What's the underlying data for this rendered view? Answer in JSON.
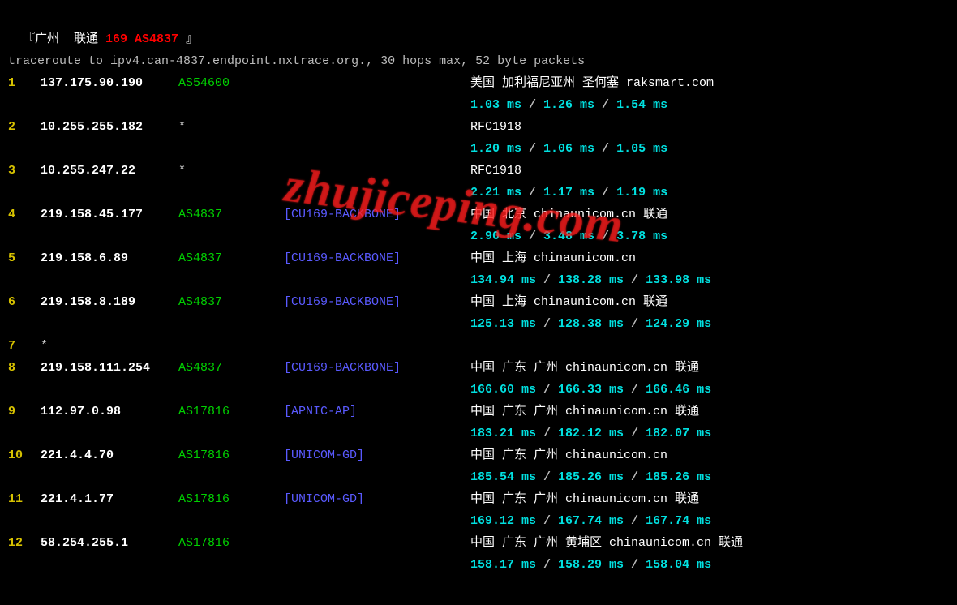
{
  "header": {
    "bracket_open": "『",
    "location": "广州  联通",
    "asn_text": " 169 AS4837",
    "bracket_close": " 』"
  },
  "trace_cmd": "traceroute to ipv4.can-4837.endpoint.nxtrace.org., 30 hops max, 52 byte packets",
  "watermark": "zhujiceping.com",
  "hops": [
    {
      "n": "1",
      "ip": "137.175.90.190",
      "asn": "AS54600",
      "tag": "",
      "loc": "美国 加利福尼亚州 圣何塞  raksmart.com",
      "lat": [
        "1.03 ms",
        "1.26 ms",
        "1.54 ms"
      ]
    },
    {
      "n": "2",
      "ip": "10.255.255.182",
      "asn": "*",
      "tag": "",
      "loc": "RFC1918",
      "lat": [
        "1.20 ms",
        "1.06 ms",
        "1.05 ms"
      ]
    },
    {
      "n": "3",
      "ip": "10.255.247.22",
      "asn": "*",
      "tag": "",
      "loc": "RFC1918",
      "lat": [
        "2.21 ms",
        "1.17 ms",
        "1.19 ms"
      ]
    },
    {
      "n": "4",
      "ip": "219.158.45.177",
      "asn": "AS4837",
      "tag": "[CU169-BACKBONE]",
      "loc": "中国 北京   chinaunicom.cn  联通",
      "lat": [
        "2.90 ms",
        "3.48 ms",
        "3.78 ms"
      ]
    },
    {
      "n": "5",
      "ip": "219.158.6.89",
      "asn": "AS4837",
      "tag": "[CU169-BACKBONE]",
      "loc": "中国 上海   chinaunicom.cn",
      "lat": [
        "134.94 ms",
        "138.28 ms",
        "133.98 ms"
      ]
    },
    {
      "n": "6",
      "ip": "219.158.8.189",
      "asn": "AS4837",
      "tag": "[CU169-BACKBONE]",
      "loc": "中国 上海   chinaunicom.cn  联通",
      "lat": [
        "125.13 ms",
        "128.38 ms",
        "124.29 ms"
      ]
    },
    {
      "n": "7",
      "ip": "*",
      "asn": "",
      "tag": "",
      "loc": "",
      "lat": null
    },
    {
      "n": "8",
      "ip": "219.158.111.254",
      "asn": "AS4837",
      "tag": "[CU169-BACKBONE]",
      "loc": "中国 广东 广州 chinaunicom.cn  联通",
      "lat": [
        "166.60 ms",
        "166.33 ms",
        "166.46 ms"
      ]
    },
    {
      "n": "9",
      "ip": "112.97.0.98",
      "asn": "AS17816",
      "tag": "[APNIC-AP]",
      "loc": "中国 广东 广州  chinaunicom.cn  联通",
      "lat": [
        "183.21 ms",
        "182.12 ms",
        "182.07 ms"
      ]
    },
    {
      "n": "10",
      "ip": "221.4.4.70",
      "asn": "AS17816",
      "tag": "[UNICOM-GD]",
      "loc": "中国 广东 广州  chinaunicom.cn",
      "lat": [
        "185.54 ms",
        "185.26 ms",
        "185.26 ms"
      ]
    },
    {
      "n": "11",
      "ip": "221.4.1.77",
      "asn": "AS17816",
      "tag": "[UNICOM-GD]",
      "loc": "中国 广东 广州  chinaunicom.cn  联通",
      "lat": [
        "169.12 ms",
        "167.74 ms",
        "167.74 ms"
      ]
    },
    {
      "n": "12",
      "ip": "58.254.255.1",
      "asn": "AS17816",
      "tag": "",
      "loc": "中国 广东 广州 黄埔区 chinaunicom.cn  联通",
      "lat": [
        "158.17 ms",
        "158.29 ms",
        "158.04 ms"
      ]
    }
  ]
}
